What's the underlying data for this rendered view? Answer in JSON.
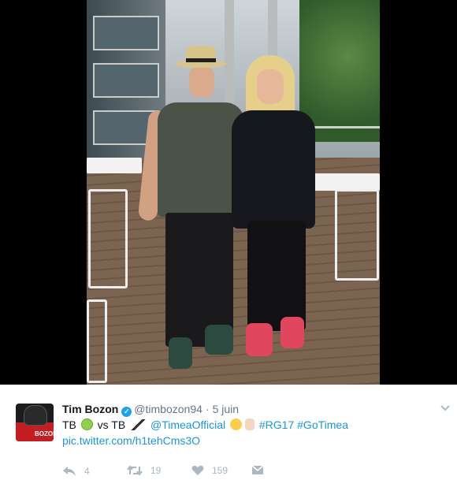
{
  "tweet": {
    "author_name": "Tim Bozon",
    "verified_badge": "✓",
    "handle": "@timbozon94",
    "separator": "·",
    "date": "5 juin",
    "avatar_text": "BOZON",
    "text": {
      "part1": "TB",
      "part2": "vs TB",
      "mention": "@TimeaOfficial",
      "hashtags": "#RG17 #GoTimea"
    },
    "media_link": "pic.twitter.com/h1tehCms3O",
    "actions": {
      "reply_count": "4",
      "retweet_count": "19",
      "like_count": "159"
    }
  },
  "icons": [
    "tennis-ball-emoji",
    "hockey-stick-emoji",
    "winking-face-emoji",
    "hand-emoji",
    "verified-icon",
    "chevron-down-icon",
    "reply-icon",
    "retweet-icon",
    "heart-icon",
    "message-icon"
  ],
  "colors": {
    "link": "#1b95e0",
    "verified": "#1da1f2",
    "muted": "#657786",
    "action": "#aab8c2"
  }
}
